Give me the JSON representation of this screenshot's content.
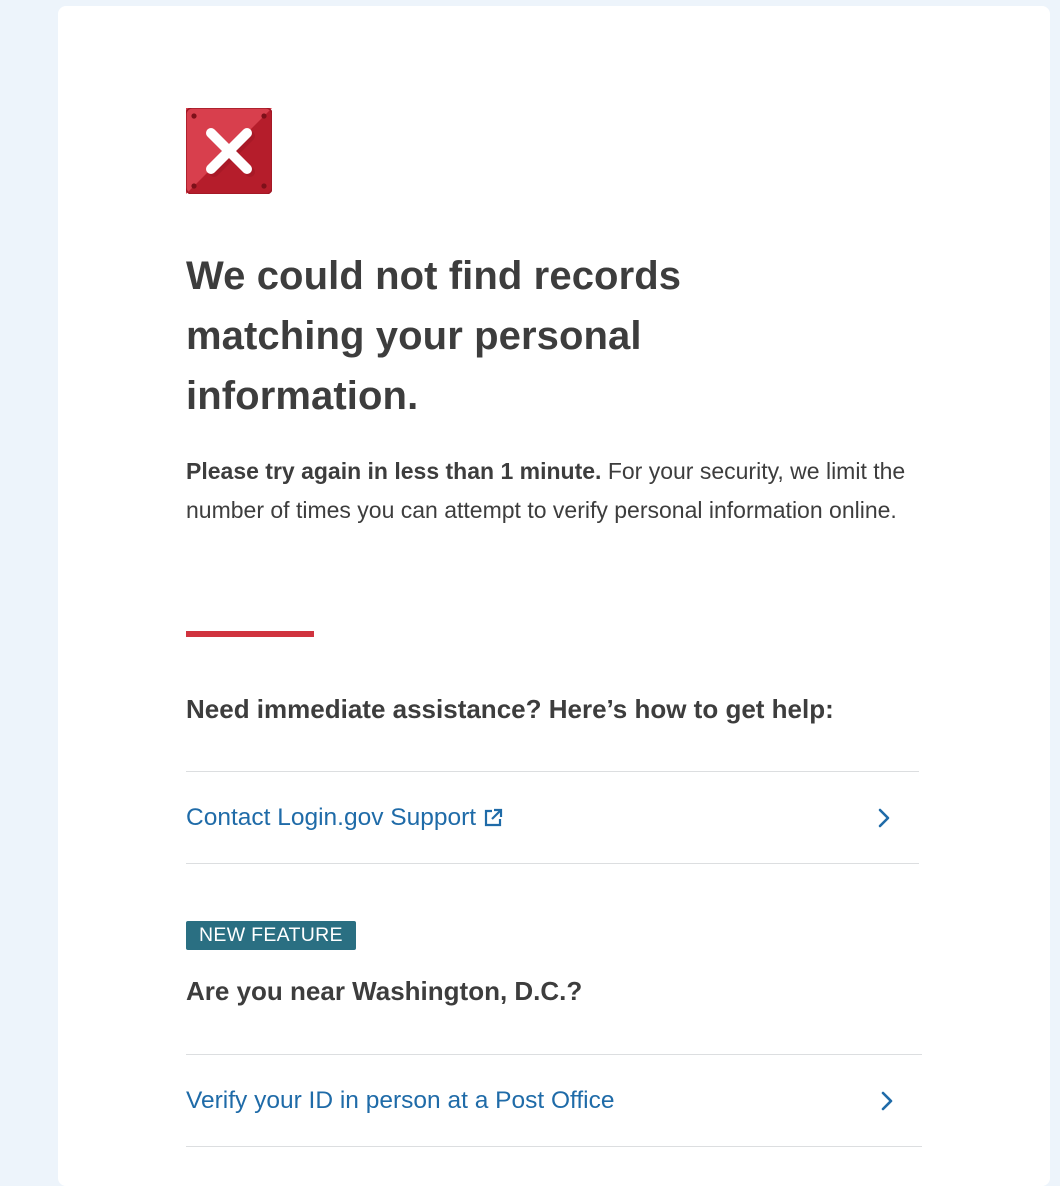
{
  "page": {
    "heading": "We could not find records matching your personal information.",
    "intro_bold": "Please try again in less than 1 minute.",
    "intro_rest": " For your security, we limit the number of times you can attempt to verify personal information online.",
    "help_heading": "Need immediate assistance? Here’s how to get help:",
    "support_link": "Contact Login.gov Support",
    "badge": "NEW FEATURE",
    "dc_heading": "Are you near Washington, D.C.?",
    "post_office_link": "Verify your ID in person at a Post Office"
  },
  "icons": {
    "error": "error-x-icon",
    "external": "external-link-icon",
    "chevron": "chevron-right-icon"
  },
  "colors": {
    "accent": "#d0333e",
    "link": "#1f6ba8",
    "badge": "#2a6f82",
    "background": "#edf4fb"
  }
}
